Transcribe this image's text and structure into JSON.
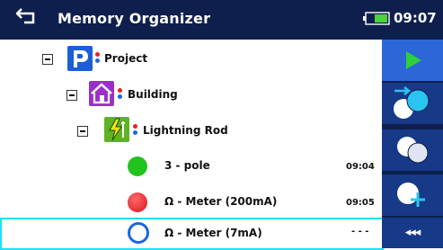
{
  "header": {
    "title": "Memory Organizer",
    "time": "09:07"
  },
  "tree": {
    "project": {
      "label": "Project"
    },
    "building": {
      "label": "Building"
    },
    "lightning_rod": {
      "label": "Lightning Rod"
    },
    "measurements": [
      {
        "label": "3 - pole",
        "time": "09:04",
        "status": "pass",
        "color": "#22c21f"
      },
      {
        "label": "Ω - Meter (200mA)",
        "time": "09:05",
        "status": "fail",
        "color": "#e8202c"
      },
      {
        "label": "Ω - Meter (7mA)",
        "time": "- - -",
        "status": "empty",
        "color": "#1a66e0"
      }
    ]
  },
  "sidebar": {
    "collapse_label": "◂◂◂"
  },
  "colors": {
    "header_bg": "#0e1f4d",
    "accent_blue": "#2b67d6",
    "selection_border": "#1ee0f3",
    "play_green": "#2fcf3a"
  }
}
